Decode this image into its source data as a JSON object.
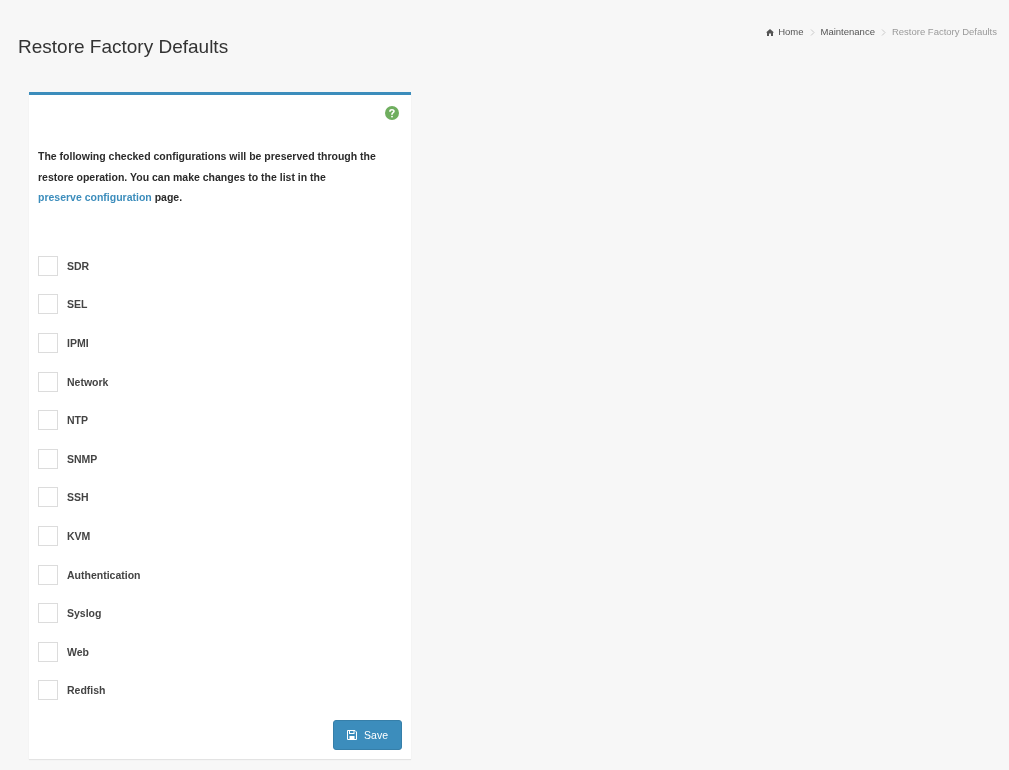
{
  "breadcrumb": [
    {
      "label": "Home",
      "kind": "home",
      "current": false
    },
    {
      "label": "Maintenance",
      "kind": "link",
      "current": false
    },
    {
      "label": "Restore Factory Defaults",
      "kind": "link",
      "current": true
    }
  ],
  "page_title": "Restore Factory Defaults",
  "panel": {
    "description": "The following checked configurations will be preserved through the restore operation. You can make changes to the list in the",
    "link": "preserve configuration",
    "description_end": "page.",
    "options": [
      {
        "label": "SDR",
        "checked": false
      },
      {
        "label": "SEL",
        "checked": false
      },
      {
        "label": "IPMI",
        "checked": false
      },
      {
        "label": "Network",
        "checked": false
      },
      {
        "label": "NTP",
        "checked": false
      },
      {
        "label": "SNMP",
        "checked": false
      },
      {
        "label": "SSH",
        "checked": false
      },
      {
        "label": "KVM",
        "checked": false
      },
      {
        "label": "Authentication",
        "checked": false
      },
      {
        "label": "Syslog",
        "checked": false
      },
      {
        "label": "Web",
        "checked": false
      },
      {
        "label": "Redfish",
        "checked": false
      }
    ],
    "save_button": "Save"
  }
}
